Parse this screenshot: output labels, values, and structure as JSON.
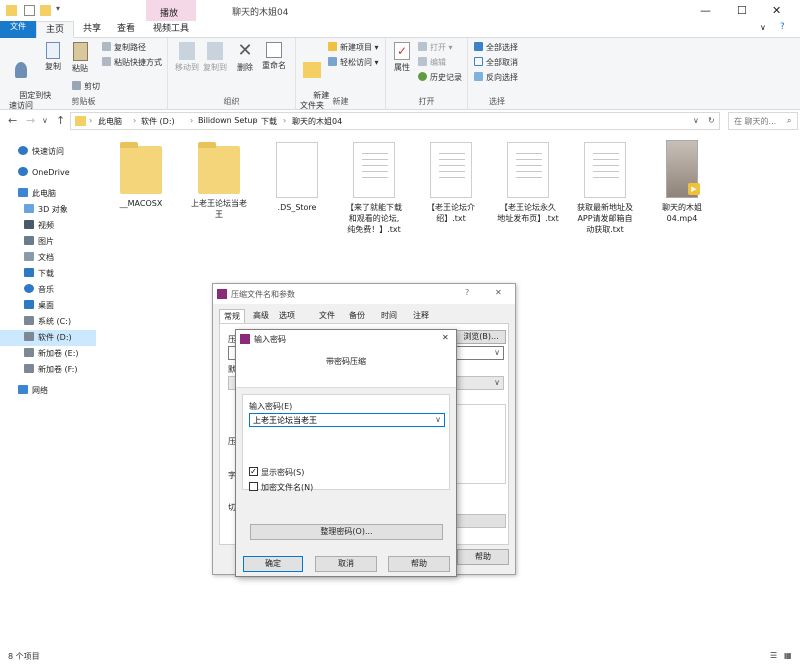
{
  "window": {
    "title": "聊天的木姐04",
    "context_tab": "播放"
  },
  "tabs": [
    "文件",
    "主页",
    "共享",
    "查看",
    "视频工具"
  ],
  "ribbon": {
    "clipboard": {
      "label": "剪贴板",
      "pin": "固定到快\n速访问",
      "copy": "复制",
      "paste": "粘贴",
      "copy_path": "复制路径",
      "paste_shortcut": "粘贴快捷方式",
      "cut": "剪切"
    },
    "organize": {
      "label": "组织",
      "move_to": "移动到",
      "copy_to": "复制到",
      "delete": "删除",
      "rename": "重命名"
    },
    "new": {
      "label": "新建",
      "new_folder": "新建\n文件夹",
      "new_item": "新建项目 ▾",
      "easy_access": "轻松访问 ▾"
    },
    "open": {
      "label": "打开",
      "properties": "属性",
      "open": "打开 ▾",
      "edit": "编辑",
      "history": "历史记录"
    },
    "select": {
      "label": "选择",
      "select_all": "全部选择",
      "select_none": "全部取消",
      "invert": "反向选择"
    }
  },
  "address": {
    "crumbs": [
      "此电脑",
      "软件 (D:)",
      "Bilidown Setup",
      "下载",
      "聊天的木姐04"
    ],
    "search_placeholder": "在 聊天的..."
  },
  "sidebar": {
    "items": [
      {
        "label": "快速访问",
        "icon": "star-icon"
      },
      {
        "label": "OneDrive",
        "icon": "cloud-icon"
      },
      {
        "label": "此电脑",
        "icon": "pc-icon"
      },
      {
        "label": "3D 对象",
        "icon": "cube-icon"
      },
      {
        "label": "视频",
        "icon": "video-icon"
      },
      {
        "label": "图片",
        "icon": "picture-icon"
      },
      {
        "label": "文档",
        "icon": "document-icon"
      },
      {
        "label": "下载",
        "icon": "download-icon"
      },
      {
        "label": "音乐",
        "icon": "music-icon"
      },
      {
        "label": "桌面",
        "icon": "desktop-icon"
      },
      {
        "label": "系统 (C:)",
        "icon": "drive-icon"
      },
      {
        "label": "软件 (D:)",
        "icon": "drive-icon",
        "selected": true
      },
      {
        "label": "新加卷 (E:)",
        "icon": "drive-icon"
      },
      {
        "label": "新加卷 (F:)",
        "icon": "drive-icon"
      },
      {
        "label": "网络",
        "icon": "network-icon"
      }
    ]
  },
  "files": [
    {
      "name": "__MACOSX",
      "type": "folder"
    },
    {
      "name": "上老王论坛当老\n王",
      "type": "folder"
    },
    {
      "name": ".DS_Store",
      "type": "file"
    },
    {
      "name": "【来了就能下载\n和观看的论坛,\n纯免费！】.txt",
      "type": "txt"
    },
    {
      "name": "【老王论坛介\n绍】.txt",
      "type": "txt"
    },
    {
      "name": "【老王论坛永久\n地址发布页】.txt",
      "type": "txt"
    },
    {
      "name": "获取最新地址及\nAPP请发邮箱自\n动获取.txt",
      "type": "txt"
    },
    {
      "name": "聊天的木姐\n04.mp4",
      "type": "video"
    }
  ],
  "status": {
    "count": "8 个项目"
  },
  "compress_dialog": {
    "title": "压缩文件名和参数",
    "help_glyph": "?",
    "tabs": [
      "常规",
      "高级",
      "选项",
      "文件",
      "备份",
      "时间",
      "注释"
    ],
    "browse": "浏览(B)...",
    "help": "帮助",
    "partial_labels": [
      "压",
      "默",
      "压",
      "字",
      "切"
    ]
  },
  "password_dialog": {
    "title": "输入密码",
    "header": "带密码压缩",
    "input_label": "输入密码(E)",
    "password_value": "上老王论坛当老王",
    "show_password": "显示密码(S)",
    "show_password_checked": true,
    "encrypt_names": "加密文件名(N)",
    "encrypt_names_checked": false,
    "organize": "整理密码(O)...",
    "ok": "确定",
    "cancel": "取消",
    "help": "帮助"
  }
}
